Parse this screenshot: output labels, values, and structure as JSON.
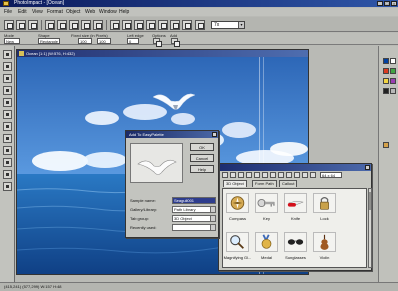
{
  "window": {
    "title": "PhotoImpact - [Ocean]"
  },
  "menu": [
    "File",
    "Edit",
    "View",
    "Format",
    "Object",
    "Web",
    "Window",
    "Help"
  ],
  "toolbar": {
    "zoom_value": "7x"
  },
  "options_bar": {
    "mode_label": "Mode",
    "mode_value": "New",
    "shape_label": "Shape",
    "shape_value": "Rectangle",
    "fixed_size_label": "Fixed size (in Pixels)",
    "width_value": "100",
    "height_value": "100",
    "left_edge_label": "Left edge",
    "left_value": "0",
    "options_label": "Options",
    "add_label": "Add"
  },
  "document": {
    "title": "Ocean [1:1] (W:576, H:432)"
  },
  "dialog": {
    "title": "Add To EasyPalette",
    "ok_label": "OK",
    "cancel_label": "Cancel",
    "help_label": "Help",
    "sample_name_label": "Sample name:",
    "sample_name_value": "Seagull001",
    "gallery_library_label": "Gallery/Library:",
    "gallery_library_value": "Path Library",
    "tab_group_label": "Tab group:",
    "tab_group_value": "3D Object",
    "recently_used_label": "Recently used:",
    "recently_used_value": ""
  },
  "palette": {
    "size_value": "64 x 64",
    "tabs": [
      "3D Object",
      "Form Path",
      "Callout"
    ],
    "items": [
      {
        "label": "Compass"
      },
      {
        "label": "Key"
      },
      {
        "label": "Knife"
      },
      {
        "label": "Lock"
      },
      {
        "label": "Magnifying Gl..."
      },
      {
        "label": "Medal"
      },
      {
        "label": "Sunglasses"
      },
      {
        "label": "Violin"
      }
    ]
  },
  "status": {
    "text": "(415,241) (577,299) W:157 H:48"
  },
  "colors": {
    "titlebar_dark": "#0b1a5b",
    "selection": "#2d3c8d",
    "sky": "#4f8fd8",
    "ocean": "#1f5ea8",
    "knife_red": "#d3101b",
    "lock_gold": "#c9a24b",
    "violin_brown": "#a05a22"
  }
}
